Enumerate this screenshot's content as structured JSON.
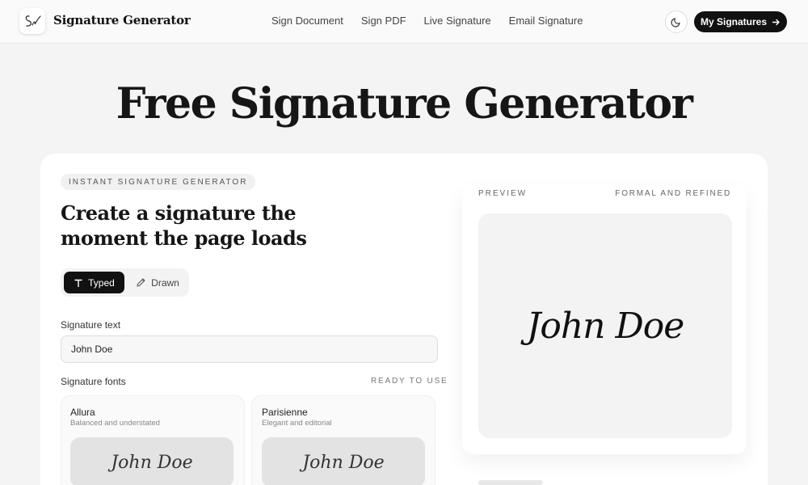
{
  "header": {
    "brand": "Signature Generator",
    "logo_icon": "signature-logo-icon",
    "nav": [
      "Sign Document",
      "Sign PDF",
      "Live Signature",
      "Email Signature"
    ],
    "theme_icon": "moon-icon",
    "my_signatures_label": "My Signatures",
    "my_signatures_icon": "arrow-right-icon"
  },
  "hero": {
    "title": "Free Signature Generator"
  },
  "generator": {
    "eyebrow": "INSTANT SIGNATURE GENERATOR",
    "title": "Create a signature the moment the page loads",
    "modes": [
      {
        "label": "Typed",
        "icon": "text-icon",
        "active": true
      },
      {
        "label": "Drawn",
        "icon": "pencil-icon",
        "active": false
      }
    ],
    "signature_text_label": "Signature text",
    "signature_text_value": "John Doe",
    "fonts_label": "Signature fonts",
    "fonts_status": "READY TO USE",
    "fonts": [
      {
        "name": "Allura",
        "description": "Balanced and understated",
        "sample": "John Doe"
      },
      {
        "name": "Parisienne",
        "description": "Elegant and editorial",
        "sample": "John Doe"
      }
    ]
  },
  "preview": {
    "label": "PREVIEW",
    "style": "FORMAL AND REFINED",
    "signature": "John Doe"
  }
}
